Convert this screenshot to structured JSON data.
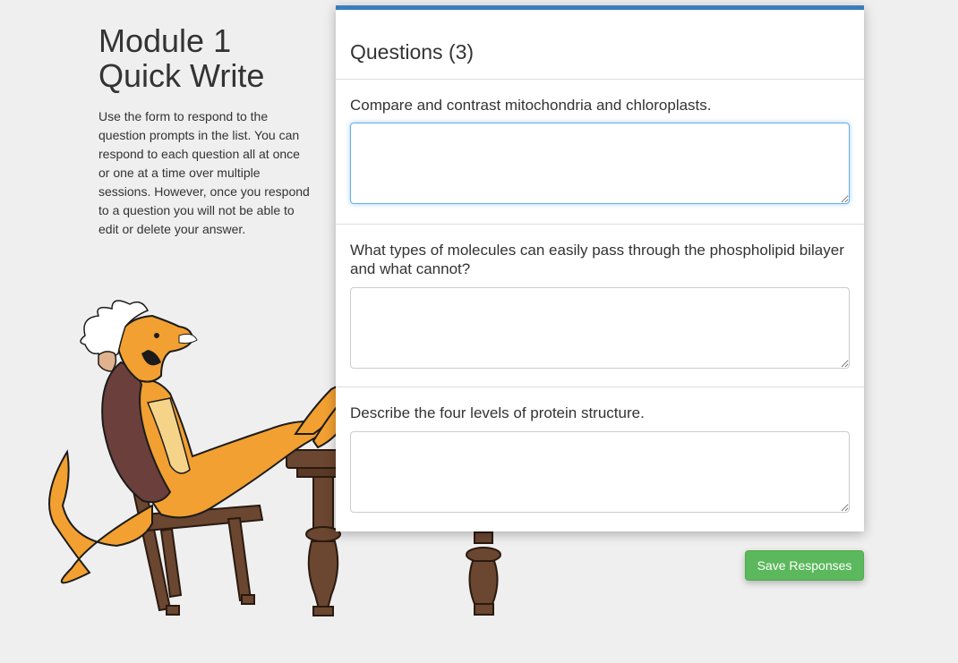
{
  "intro": {
    "title_line1": "Module 1",
    "title_line2": "Quick Write",
    "description": "Use the form to respond to the question prompts in the list. You can respond to each question all at once or one at a time over multiple sessions. However, once you respond to a question you will not be able to edit or delete your answer."
  },
  "questions_panel": {
    "title": "Questions (3)",
    "accent_color": "#3a7dbd",
    "questions": [
      {
        "prompt": "Compare and contrast mitochondria and chloroplasts.",
        "value": ""
      },
      {
        "prompt": "What types of molecules can easily pass through the phospholipid bilayer and what cannot?",
        "value": ""
      },
      {
        "prompt": "Describe the four levels of protein structure.",
        "value": ""
      }
    ]
  },
  "actions": {
    "save_label": "Save Responses",
    "save_color": "#5cb85c"
  },
  "illustration": {
    "icon": "lizard-scientist-mascot"
  }
}
